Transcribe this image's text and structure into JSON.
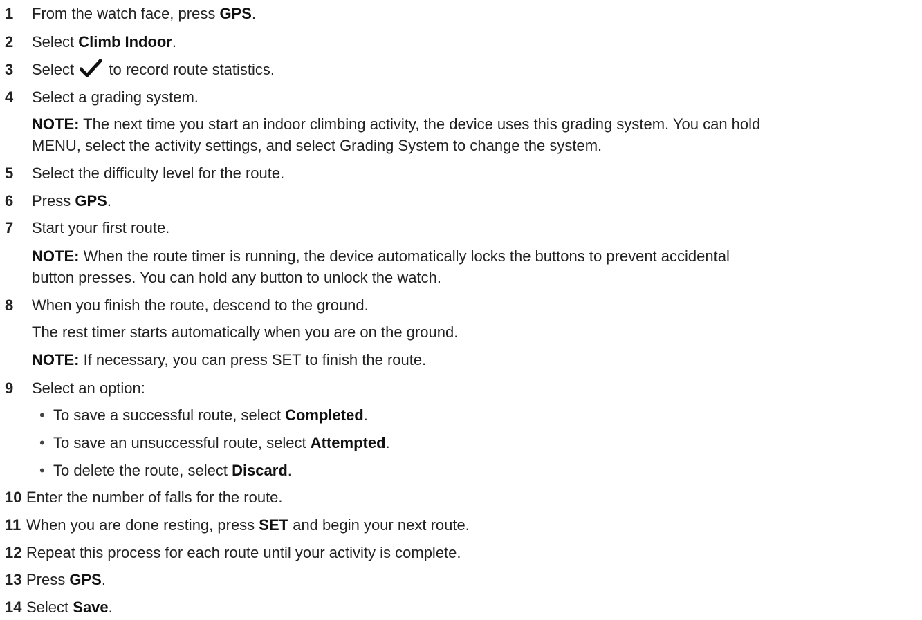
{
  "steps": {
    "s1": {
      "num": "1",
      "pre": "From the watch face, press ",
      "bold": "GPS",
      "post": "."
    },
    "s2": {
      "num": "2",
      "pre": "Select ",
      "bold": "Climb Indoor",
      "post": "."
    },
    "s3": {
      "num": "3",
      "pre": "Select ",
      "icon": "checkmark-icon",
      "post": " to record route statistics."
    },
    "s4": {
      "num": "4",
      "text": "Select a grading system."
    },
    "n4": {
      "label": "NOTE:",
      "line1": " The next time you start an indoor climbing activity, the device uses this grading system. You can hold",
      "line2": "MENU, select the activity settings, and select Grading System to change the system."
    },
    "s5": {
      "num": "5",
      "text": "Select the difficulty level for the route."
    },
    "s6": {
      "num": "6",
      "pre": "Press ",
      "bold": "GPS",
      "post": "."
    },
    "s7": {
      "num": "7",
      "text": "Start your first route."
    },
    "n7": {
      "label": "NOTE:",
      "line1": " When the route timer is running, the device automatically locks the buttons to prevent accidental",
      "line2": "button presses. You can hold any button to unlock the watch."
    },
    "s8": {
      "num": "8",
      "text": "When you finish the route, descend to the ground."
    },
    "s8b": {
      "text": "The rest timer starts automatically when you are on the ground."
    },
    "n8": {
      "label": "NOTE:",
      "text": " If necessary, you can press SET to finish the route."
    },
    "s9": {
      "num": "9",
      "text": "Select an option:"
    },
    "b1": {
      "bullet": "•",
      "pre": "To save a successful route, select ",
      "bold": "Completed",
      "post": "."
    },
    "b2": {
      "bullet": "•",
      "pre": "To save an unsuccessful route, select ",
      "bold": "Attempted",
      "post": "."
    },
    "b3": {
      "bullet": "•",
      "pre": "To delete the route, select ",
      "bold": "Discard",
      "post": "."
    },
    "s10": {
      "num": "10",
      "text": "Enter the number of falls for the route."
    },
    "s11": {
      "num": "11",
      "pre": "When you are done resting, press ",
      "bold": "SET",
      "post": " and begin your next route."
    },
    "s12": {
      "num": "12",
      "text": "Repeat this process for each route until your activity is complete."
    },
    "s13": {
      "num": "13",
      "pre": "Press ",
      "bold": "GPS",
      "post": "."
    },
    "s14": {
      "num": "14",
      "pre": "Select ",
      "bold": "Save",
      "post": "."
    }
  },
  "colors": {
    "text": "#222222",
    "background": "#ffffff"
  }
}
